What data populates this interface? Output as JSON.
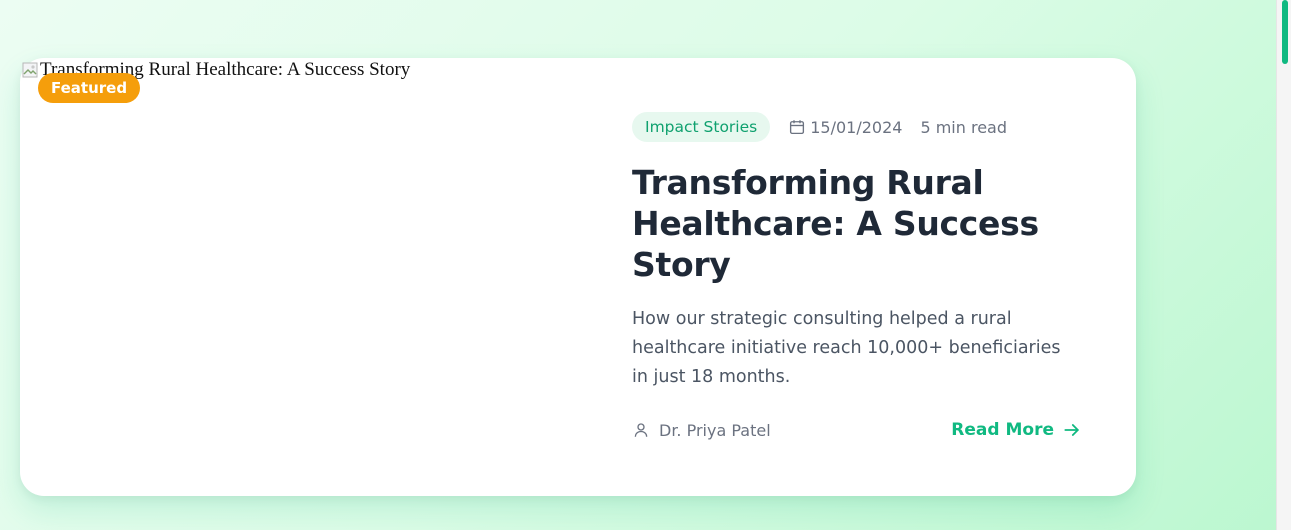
{
  "card": {
    "image_alt": "Transforming Rural Healthcare: A Success Story",
    "badge": "Featured",
    "category": "Impact Stories",
    "date": "15/01/2024",
    "read_time": "5 min read",
    "title": "Transforming Rural Healthcare: A Success Story",
    "excerpt": "How our strategic consulting helped a rural healthcare initiative reach 10,000+ beneficiaries in just 18 months.",
    "author": "Dr. Priya Patel",
    "cta": "Read More"
  },
  "icons": {
    "broken_image": "broken-image-icon",
    "calendar": "calendar-icon",
    "user": "user-icon",
    "arrow": "arrow-right-icon"
  },
  "colors": {
    "accent": "#10b981",
    "badge": "#f59e0b",
    "title": "#1f2937",
    "text": "#4b5563",
    "muted": "#6b7280"
  }
}
